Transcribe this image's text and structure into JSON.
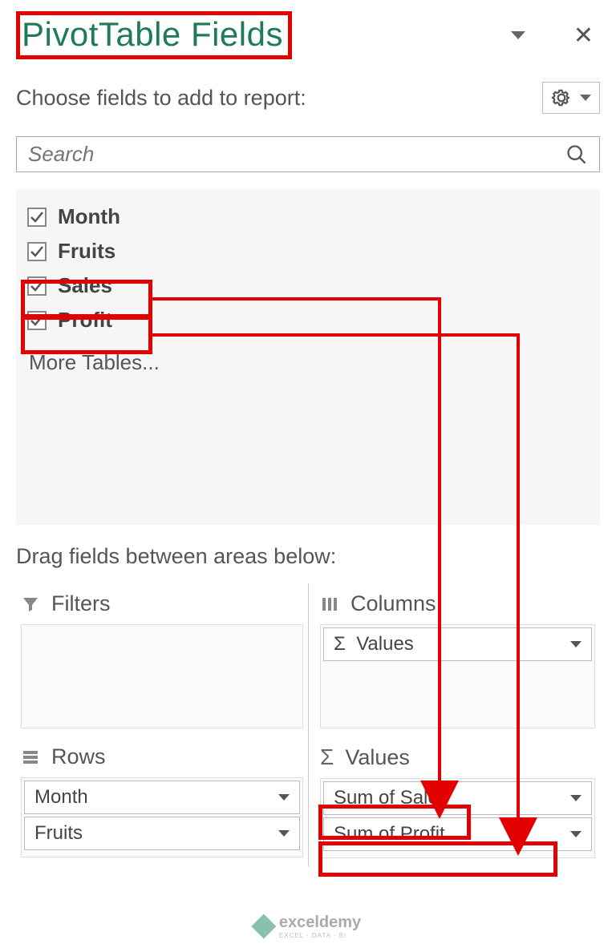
{
  "header": {
    "title": "PivotTable Fields",
    "choose_label": "Choose fields to add to report:"
  },
  "search": {
    "placeholder": "Search"
  },
  "fields": [
    {
      "label": "Month",
      "checked": true
    },
    {
      "label": "Fruits",
      "checked": true
    },
    {
      "label": "Sales",
      "checked": true,
      "highlight": true
    },
    {
      "label": "Profit",
      "checked": true,
      "highlight": true
    }
  ],
  "more_tables": "More Tables...",
  "drag_label": "Drag fields between areas below:",
  "areas": {
    "filters": {
      "title": "Filters",
      "items": []
    },
    "columns": {
      "title": "Columns",
      "items": [
        "Values"
      ]
    },
    "rows": {
      "title": "Rows",
      "items": [
        "Month",
        "Fruits"
      ]
    },
    "values": {
      "title": "Values",
      "items": [
        "Sum of Sales",
        "Sum of Profit"
      ]
    }
  },
  "watermark": {
    "name": "exceldemy",
    "sub": "EXCEL · DATA · BI"
  }
}
